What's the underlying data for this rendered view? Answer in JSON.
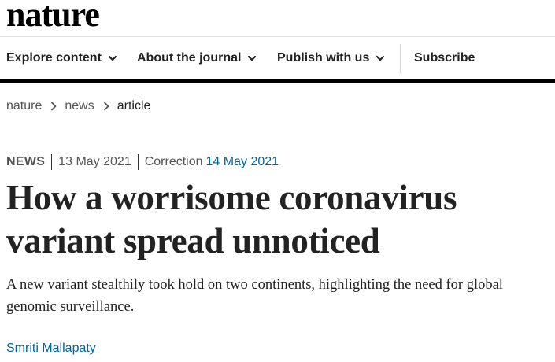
{
  "header": {
    "logo_text": "nature"
  },
  "nav": {
    "items": [
      {
        "label": "Explore content",
        "has_dropdown": true,
        "icon": "chevron-down-icon"
      },
      {
        "label": "About the journal",
        "has_dropdown": true,
        "icon": "chevron-down-icon"
      },
      {
        "label": "Publish with us",
        "has_dropdown": true,
        "icon": "chevron-down-icon"
      }
    ],
    "subscribe_label": "Subscribe"
  },
  "breadcrumb": {
    "items": [
      {
        "label": "nature",
        "link": true
      },
      {
        "label": "news",
        "link": true
      },
      {
        "label": "article",
        "link": false
      }
    ],
    "separator_icon": "chevron-right-icon"
  },
  "article": {
    "type": "NEWS",
    "published_date": "13 May 2021",
    "correction_label": "Correction",
    "correction_date": "14 May 2021",
    "title": "How a worrisome coronavirus variant spread unnoticed",
    "standfirst": "A new variant stealthily took hold on two continents, highlighting the need for global genomic surveillance.",
    "author": "Smriti Mallapaty"
  },
  "colors": {
    "link": "#006699",
    "text": "#222222",
    "muted": "#555555",
    "nav_rule": "#000000"
  }
}
